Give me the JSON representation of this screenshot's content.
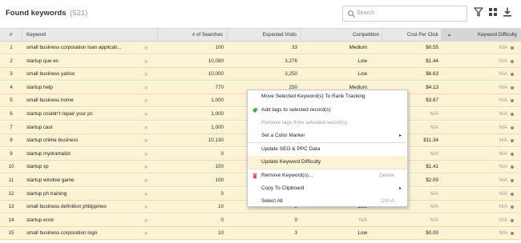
{
  "header": {
    "title": "Found keywords",
    "count": "(521)",
    "search_placeholder": "Search"
  },
  "toolbar": {
    "filter_icon": "filter-icon",
    "grid_icon": "grid-icon",
    "download_icon": "download-icon"
  },
  "columns": {
    "index": "#",
    "keyword": "Keyword",
    "searches": "# of Searches",
    "visits": "Expected Visits",
    "competition": "Competition",
    "cpc": "Cost Per Click",
    "difficulty": "Keyword Difficulty",
    "sort_indicator": "▲"
  },
  "rows": [
    {
      "idx": "1",
      "keyword": "small business corporation loan applicati...",
      "searches": "100",
      "visits": "33",
      "competition": "Medium",
      "cpc": "$0.55",
      "difficulty": "N/A"
    },
    {
      "idx": "2",
      "keyword": "startup que es",
      "searches": "10,080",
      "visits": "3,276",
      "competition": "Low",
      "cpc": "$1.44",
      "difficulty": "N/A"
    },
    {
      "idx": "3",
      "keyword": "small business yahoo",
      "searches": "10,000",
      "visits": "3,250",
      "competition": "Low",
      "cpc": "$6.63",
      "difficulty": "N/A"
    },
    {
      "idx": "4",
      "keyword": "startup help",
      "searches": "770",
      "visits": "250",
      "competition": "Medium",
      "cpc": "$4.13",
      "difficulty": "N/A"
    },
    {
      "idx": "5",
      "keyword": "small business home",
      "searches": "1,000",
      "visits": "",
      "competition": "",
      "cpc": "$3.67",
      "difficulty": "N/A"
    },
    {
      "idx": "6",
      "keyword": "startup couldn't repair your pc",
      "searches": "1,000",
      "visits": "",
      "competition": "",
      "cpc": "N/A",
      "difficulty": "N/A"
    },
    {
      "idx": "7",
      "keyword": "startup cast",
      "searches": "1,000",
      "visits": "",
      "competition": "",
      "cpc": "N/A",
      "difficulty": "N/A"
    },
    {
      "idx": "8",
      "keyword": "startup online business",
      "searches": "10,130",
      "visits": "",
      "competition": "",
      "cpc": "$11.34",
      "difficulty": "N/A"
    },
    {
      "idx": "9",
      "keyword": "startup mydramalist",
      "searches": "0",
      "visits": "",
      "competition": "",
      "cpc": "N/A",
      "difficulty": "N/A"
    },
    {
      "idx": "10",
      "keyword": "startup xp",
      "searches": "100",
      "visits": "",
      "competition": "",
      "cpc": "$1.41",
      "difficulty": "N/A"
    },
    {
      "idx": "11",
      "keyword": "startup window game",
      "searches": "100",
      "visits": "",
      "competition": "",
      "cpc": "$2.00",
      "difficulty": "N/A"
    },
    {
      "idx": "12",
      "keyword": "startup ph training",
      "searches": "0",
      "visits": "",
      "competition": "",
      "cpc": "N/A",
      "difficulty": "N/A"
    },
    {
      "idx": "13",
      "keyword": "small business definition philippines",
      "searches": "10",
      "visits": "3",
      "competition": "Low",
      "cpc": "N/A",
      "difficulty": "N/A"
    },
    {
      "idx": "14",
      "keyword": "startup error",
      "searches": "0",
      "visits": "0",
      "competition": "N/A",
      "cpc": "N/A",
      "difficulty": "N/A"
    },
    {
      "idx": "15",
      "keyword": "small business corporation logo",
      "searches": "10",
      "visits": "3",
      "competition": "Low",
      "cpc": "$0.00",
      "difficulty": "N/A"
    }
  ],
  "context_menu": {
    "items": [
      {
        "label": "Move Selected Keyword(s) To Rank Tracking",
        "disabled": false
      },
      {
        "label": "Add tags to selected record(s)",
        "disabled": false,
        "icon": "tag-icon"
      },
      {
        "label": "Remove tags from selected record(s)",
        "disabled": true
      },
      {
        "label": "Set a Color Marker",
        "disabled": false,
        "submenu": true
      },
      {
        "label": "Update SEO & PPC Data",
        "disabled": false
      },
      {
        "label": "Update Keyword Difficulty",
        "disabled": false,
        "highlighted": true
      },
      {
        "label": "Remove Keyword(s)...",
        "disabled": false,
        "shortcut": "Delete",
        "icon": "trash-icon"
      },
      {
        "label": "Copy To Clipboard",
        "disabled": false,
        "submenu": true
      },
      {
        "label": "Select All",
        "disabled": false,
        "shortcut": "Ctrl-A"
      }
    ],
    "submenu_arrow": "▸"
  },
  "colors": {
    "row_bg": "#fbf3d3",
    "header_bg": "#e9e9e9",
    "tag_icon": "#3aa635",
    "trash_icon": "#d9534f"
  }
}
